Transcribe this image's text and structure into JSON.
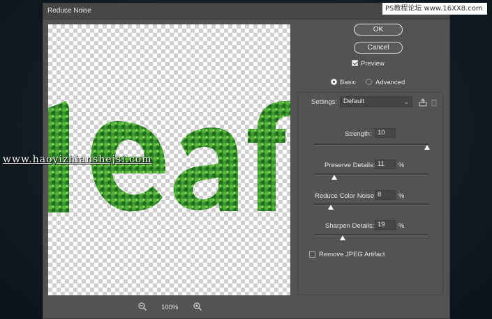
{
  "dialog": {
    "title": "Reduce Noise",
    "ok_label": "OK",
    "cancel_label": "Cancel",
    "preview_label": "Preview",
    "preview_checked": true,
    "mode_basic": "Basic",
    "mode_advanced": "Advanced",
    "mode_selected": "Basic",
    "settings_label": "Settings:",
    "settings_value": "Default",
    "strength": {
      "label": "Strength:",
      "value": "10",
      "unit": "",
      "fraction": 1.0
    },
    "preserve": {
      "label": "Preserve Details:",
      "value": "11",
      "unit": "%",
      "fraction": 0.11
    },
    "color_noise": {
      "label": "Reduce Color Noise:",
      "value": "8",
      "unit": "%",
      "fraction": 0.08
    },
    "sharpen": {
      "label": "Sharpen Details:",
      "value": "19",
      "unit": "%",
      "fraction": 0.19
    },
    "jpeg_label": "Remove JPEG Artifact",
    "jpeg_checked": false,
    "zoom": "100%"
  },
  "watermarks": {
    "top": "PS教程论坛 www.16XX8.com",
    "middle": "www.haoyizhianshejsi.com"
  },
  "icons": [
    "zoom-out-icon",
    "zoom-in-icon",
    "save-settings-icon",
    "delete-settings-icon",
    "dropdown-chevron-icon"
  ],
  "colors": {
    "dialog_bg": "#535353",
    "leaf_green": "#2f8a2a"
  }
}
